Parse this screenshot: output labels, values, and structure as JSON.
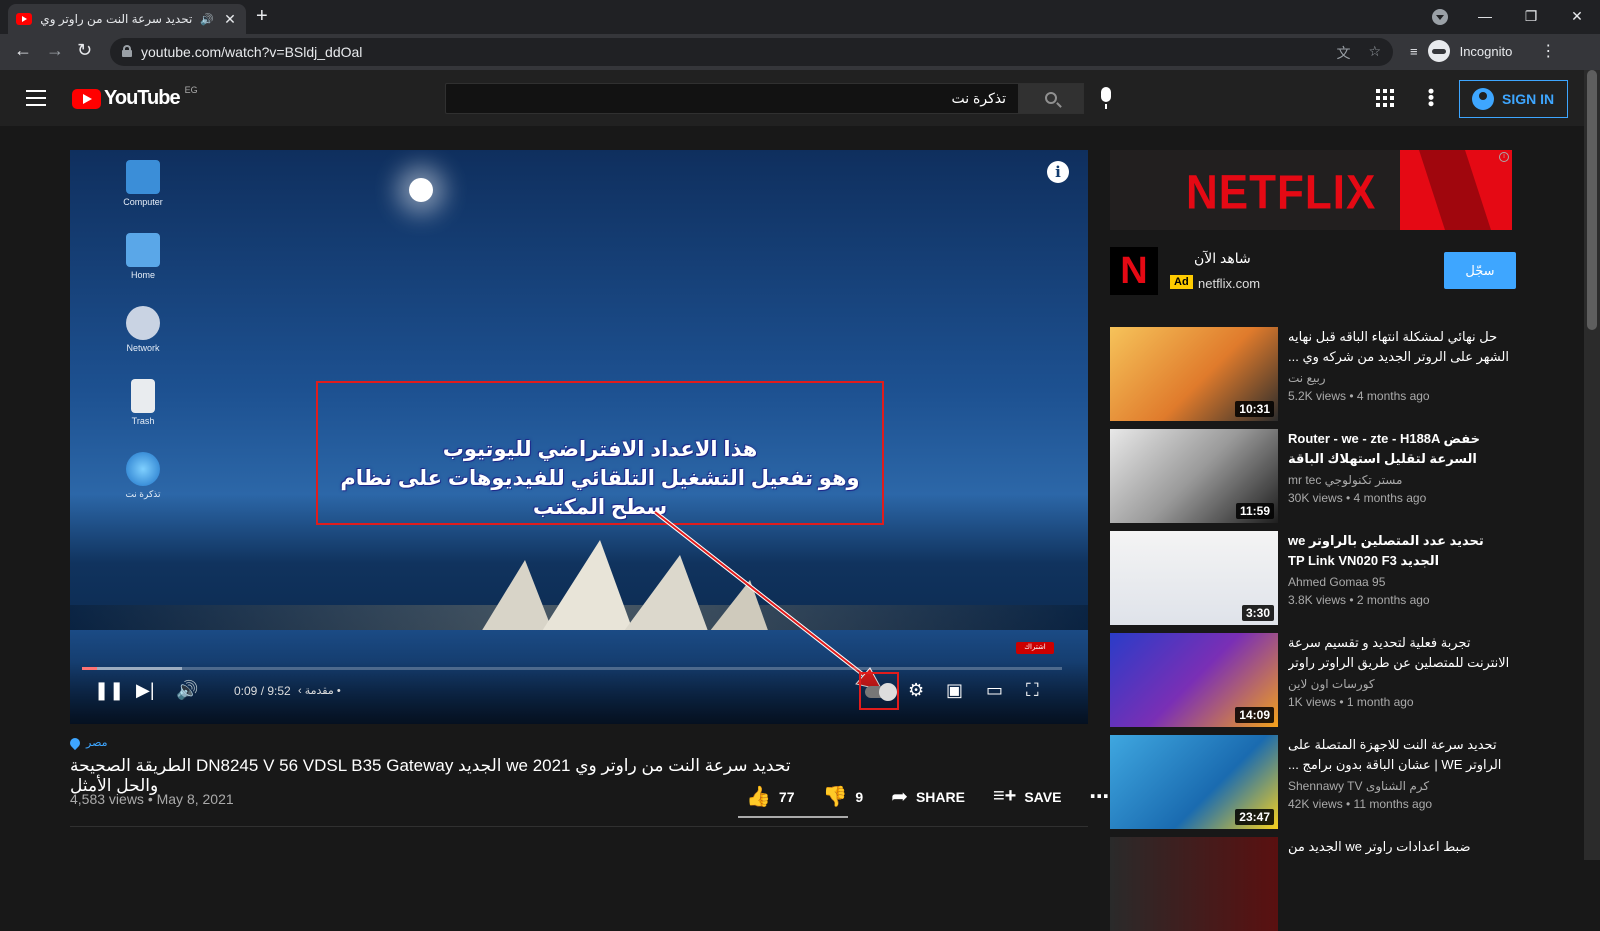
{
  "browser": {
    "tab_title": "تحديد سرعة النت من راوتر وي e",
    "tab_speaker": "🔊",
    "new_tab": "+",
    "url": "youtube.com/watch?v=BSldj_ddOal",
    "profile_label": "Incognito"
  },
  "youtube": {
    "logo_text": "YouTube",
    "country_code": "EG",
    "search_value": "تذكرة نت",
    "signin_label": "SIGN IN"
  },
  "player": {
    "desktop_icons": [
      "Computer",
      "Home",
      "Network",
      "Trash",
      "تذكرة نت"
    ],
    "annotation_line1": "هذا الاعداد الافتراضي لليوتيوب",
    "annotation_line2": "وهو تفعيل التشغيل التلقائي للفيديوهات على نظام سطح المكتب",
    "time": "0:09 / 9:52",
    "chapter": "مقدمة",
    "progress_fraction": 0.015,
    "watermark": "اشتراك"
  },
  "video": {
    "location": "مصر",
    "title": "تحديد سرعة النت من راوتر وي we 2021 الجديد DN8245 V 56 VDSL B35 Gateway الطريقة الصحيحة والحل الأمثل",
    "views_date": "4,583 views • May 8, 2021",
    "likes": "77",
    "dislikes": "9",
    "share_label": "SHARE",
    "save_label": "SAVE"
  },
  "ad": {
    "brand": "NETFLIX",
    "title": "شاهد الآن",
    "badge": "Ad",
    "domain": "netflix.com",
    "cta": "سجّل"
  },
  "recommendations": [
    {
      "title": "حل نهائي لمشكلة انتهاء الباقه قبل نهايه الشهر على الروتر الجديد من شركه وي ...",
      "channel": "ربيع نت",
      "meta": "5.2K views • 4 months ago",
      "duration": "10:31"
    },
    {
      "title": "Router - we - zte - H188A خفض السرعة لتقليل استهلاك الباقة لراوتر وى...",
      "channel": "mr tec مستر تكنولوجي",
      "meta": "30K views • 4 months ago",
      "duration": "11:59"
    },
    {
      "title": "تحديد عدد المتصلين بالراوتر we الجديد TP Link VN020 F3",
      "channel": "Ahmed Gomaa 95",
      "meta": "3.8K views • 2 months ago",
      "duration": "3:30"
    },
    {
      "title": "تجربة فعلية لتحديد و تقسيم سرعة الانترنت للمتصلين عن طريق الراوتر راوتر وي...",
      "channel": "كورسات اون لاين",
      "meta": "1K views • 1 month ago",
      "duration": "14:09"
    },
    {
      "title": "تحديد سرعة النت للاجهزة المتصلة على الراوتر WE | عشان الباقة بدون برامج ...",
      "channel": "كرم الشناوى Shennawy TV",
      "meta": "42K views • 11 months ago",
      "duration": "23:47"
    },
    {
      "title": "ضبط اعدادات راوتر we الجديد من",
      "channel": "",
      "meta": "",
      "duration": ""
    }
  ],
  "colors": {
    "accent": "#3ea6ff",
    "youtube_red": "#ff0000",
    "netflix_red": "#e50914",
    "annotation_red": "#e01c1c"
  }
}
